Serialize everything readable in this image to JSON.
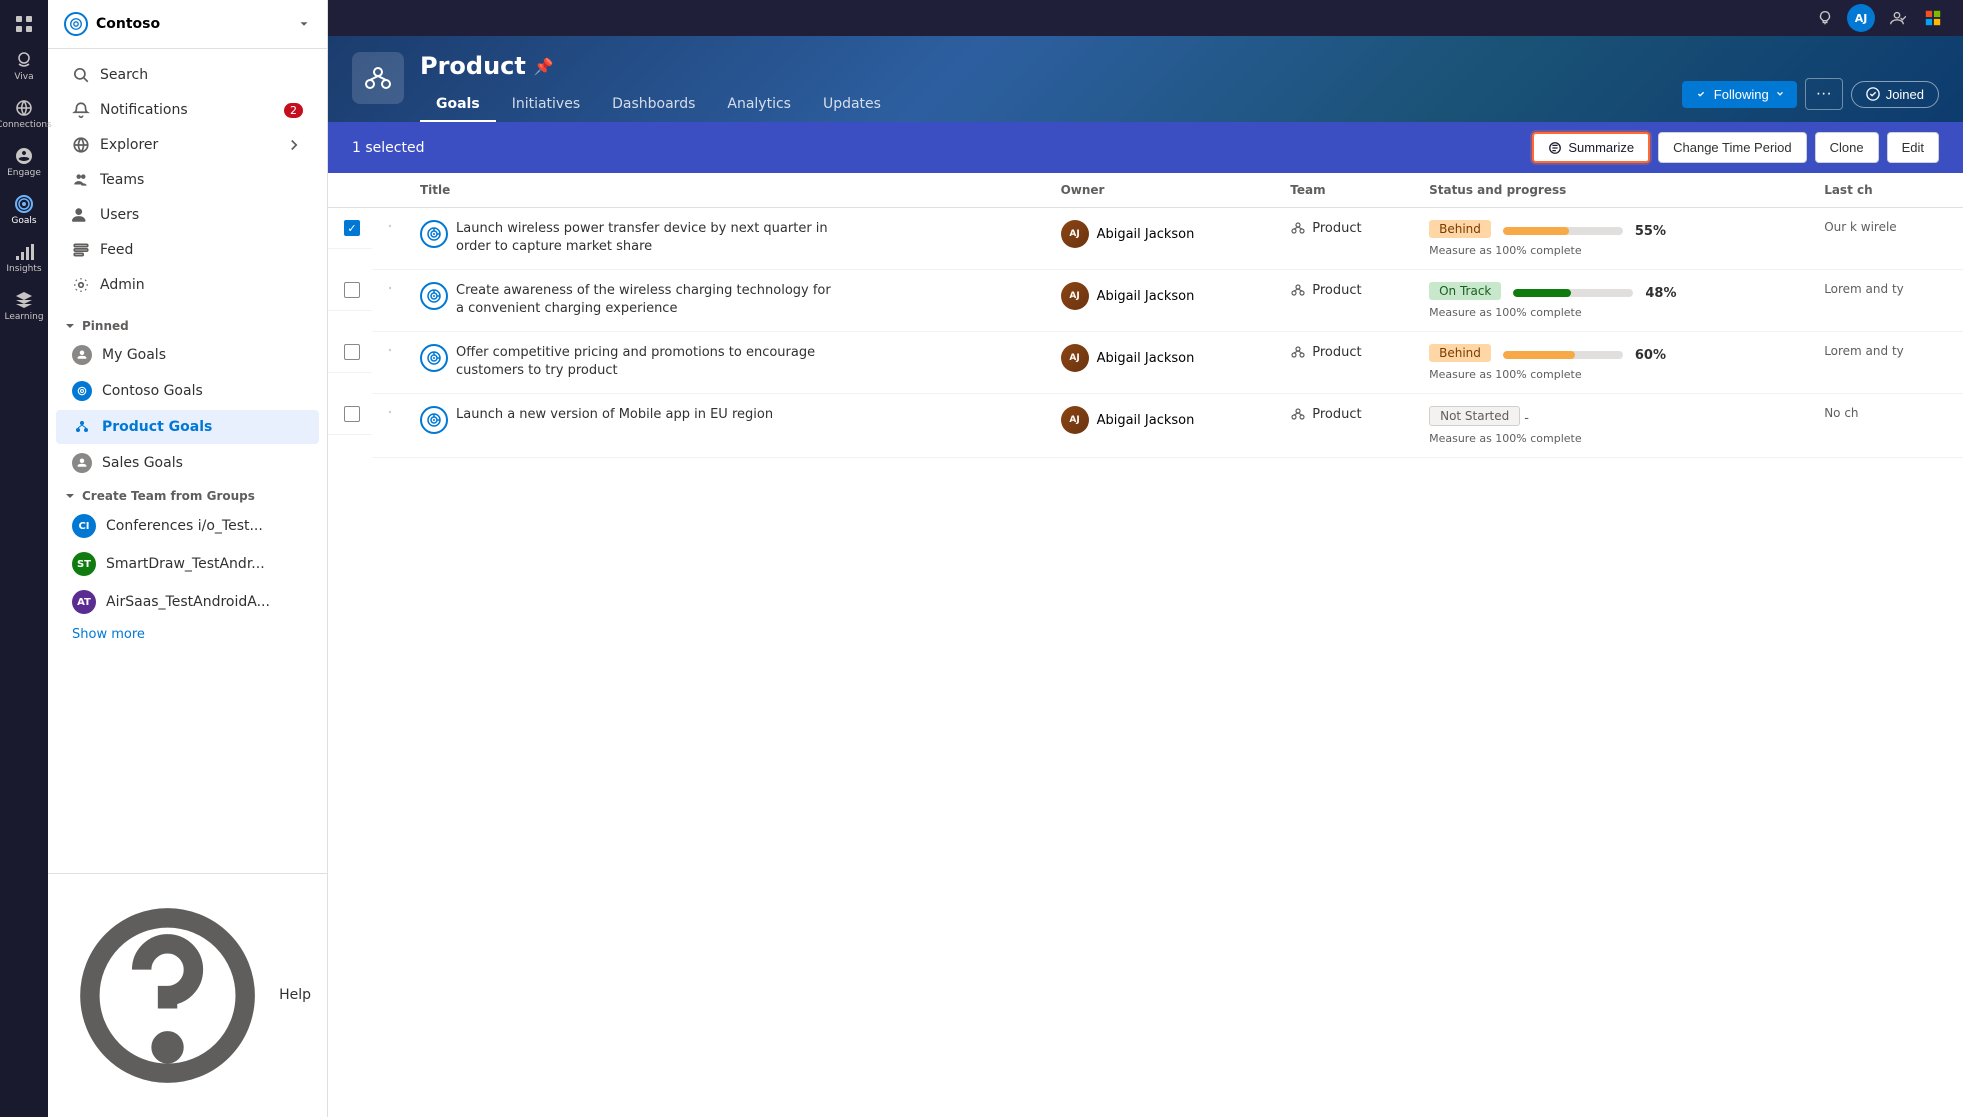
{
  "app": {
    "title": "Goals"
  },
  "rail": {
    "items": [
      {
        "id": "viva",
        "label": "Viva",
        "icon": "grid-icon"
      },
      {
        "id": "connections",
        "label": "Connections",
        "icon": "connections-icon"
      },
      {
        "id": "engage",
        "label": "Engage",
        "icon": "engage-icon"
      },
      {
        "id": "goals",
        "label": "Goals",
        "icon": "goals-icon",
        "active": true
      },
      {
        "id": "insights",
        "label": "Insights",
        "icon": "insights-icon"
      },
      {
        "id": "learning",
        "label": "Learning",
        "icon": "learning-icon"
      }
    ]
  },
  "sidebar": {
    "org_name": "Contoso",
    "nav_items": [
      {
        "id": "search",
        "label": "Search",
        "icon": "search-icon"
      },
      {
        "id": "notifications",
        "label": "Notifications",
        "icon": "bell-icon",
        "badge": "2"
      },
      {
        "id": "explorer",
        "label": "Explorer",
        "icon": "globe-icon",
        "has_arrow": true
      },
      {
        "id": "teams",
        "label": "Teams",
        "icon": "teams-icon"
      },
      {
        "id": "users",
        "label": "Users",
        "icon": "users-icon"
      },
      {
        "id": "feed",
        "label": "Feed",
        "icon": "feed-icon"
      },
      {
        "id": "admin",
        "label": "Admin",
        "icon": "admin-icon"
      }
    ],
    "pinned_section": "Pinned",
    "pinned_items": [
      {
        "id": "my-goals",
        "label": "My Goals",
        "icon": "person-icon",
        "icon_bg": "#8a8886"
      },
      {
        "id": "contoso-goals",
        "label": "Contoso Goals",
        "icon": "globe-icon",
        "icon_bg": "#0078d4"
      },
      {
        "id": "product-goals",
        "label": "Product Goals",
        "icon": "network-icon",
        "icon_bg": "#0078d4",
        "active": true
      },
      {
        "id": "sales-goals",
        "label": "Sales Goals",
        "icon": "person-icon",
        "icon_bg": "#8a8886"
      }
    ],
    "groups_section": "Create Team from Groups",
    "groups": [
      {
        "id": "conferences",
        "label": "Conferences i/o_Test...",
        "initials": "CI",
        "color": "#0078d4"
      },
      {
        "id": "smartdraw",
        "label": "SmartDraw_TestAndr...",
        "initials": "ST",
        "color": "#107c10"
      },
      {
        "id": "airsaas",
        "label": "AirSaas_TestAndroidA...",
        "initials": "AT",
        "color": "#5c2d91"
      }
    ],
    "show_more": "Show more",
    "footer": {
      "help": "Help"
    }
  },
  "page": {
    "title": "Product",
    "pin_symbol": "📌",
    "tabs": [
      {
        "id": "goals",
        "label": "Goals",
        "active": true
      },
      {
        "id": "initiatives",
        "label": "Initiatives"
      },
      {
        "id": "dashboards",
        "label": "Dashboards"
      },
      {
        "id": "analytics",
        "label": "Analytics"
      },
      {
        "id": "updates",
        "label": "Updates"
      }
    ],
    "following_label": "Following",
    "joined_label": "Joined",
    "more_options": "···"
  },
  "action_bar": {
    "selected_text": "1 selected",
    "buttons": {
      "summarize": "Summarize",
      "change_time": "Change Time Period",
      "clone": "Clone",
      "edit": "Edit"
    }
  },
  "table": {
    "columns": [
      {
        "id": "expand",
        "label": ""
      },
      {
        "id": "title",
        "label": "Title"
      },
      {
        "id": "owner",
        "label": "Owner"
      },
      {
        "id": "team",
        "label": "Team"
      },
      {
        "id": "status",
        "label": "Status and progress"
      },
      {
        "id": "last",
        "label": "Last ch"
      }
    ],
    "rows": [
      {
        "id": 1,
        "checked": true,
        "title": "Launch wireless power transfer device by next quarter in order to capture market share",
        "owner": "Abigail Jackson",
        "team": "Product",
        "status": "Behind",
        "progress": 55,
        "measure": "Measure as 100% complete",
        "last_checkin": "Our k wirele"
      },
      {
        "id": 2,
        "checked": false,
        "title": "Create awareness of the wireless charging technology for a convenient charging experience",
        "owner": "Abigail Jackson",
        "team": "Product",
        "status": "On Track",
        "progress": 48,
        "measure": "Measure as 100% complete",
        "last_checkin": "Lorem and ty"
      },
      {
        "id": 3,
        "checked": false,
        "title": "Offer competitive pricing and promotions to encourage customers to try product",
        "owner": "Abigail Jackson",
        "team": "Product",
        "status": "Behind",
        "progress": 60,
        "measure": "Measure as 100% complete",
        "last_checkin": "Lorem and ty"
      },
      {
        "id": 4,
        "checked": false,
        "title": "Launch a new version of Mobile app in EU region",
        "owner": "Abigail Jackson",
        "team": "Product",
        "status": "Not Started",
        "progress": 0,
        "measure": "Measure as 100% complete",
        "last_checkin": "No ch"
      }
    ]
  }
}
